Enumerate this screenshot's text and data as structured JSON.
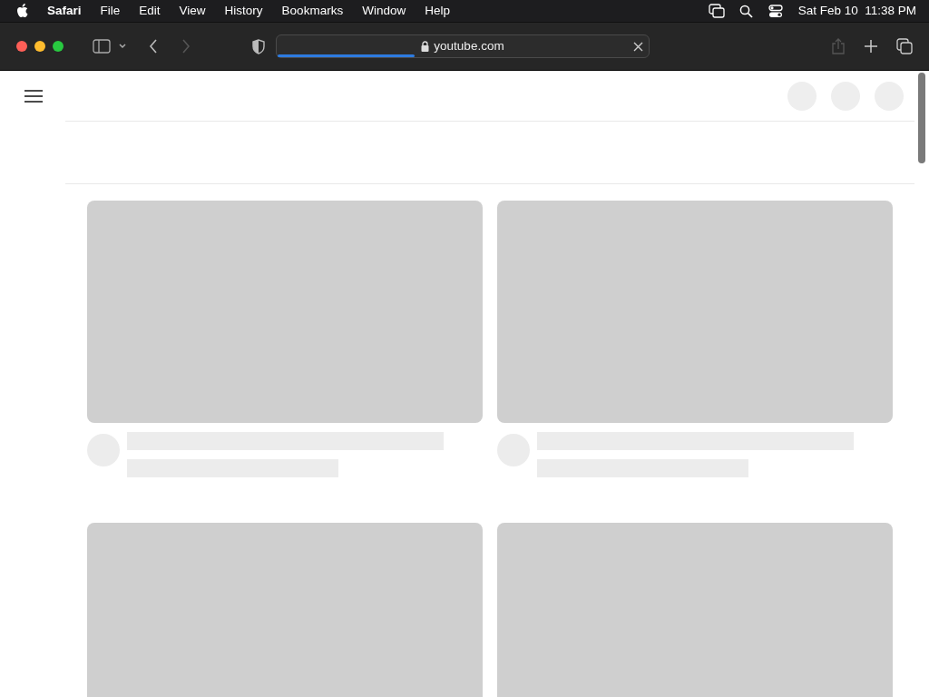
{
  "menu_bar": {
    "app": "Safari",
    "items": [
      "File",
      "Edit",
      "View",
      "History",
      "Bookmarks",
      "Window",
      "Help"
    ],
    "clock": "Sat Feb 10  11:38 PM"
  },
  "toolbar": {
    "address": "youtube.com",
    "loading": {
      "level": 0.37
    }
  },
  "page": {
    "feed": [
      {
        "kind": "skeleton"
      },
      {
        "kind": "skeleton"
      },
      {
        "kind": "thumbnail_only"
      },
      {
        "kind": "thumbnail_only"
      }
    ]
  }
}
